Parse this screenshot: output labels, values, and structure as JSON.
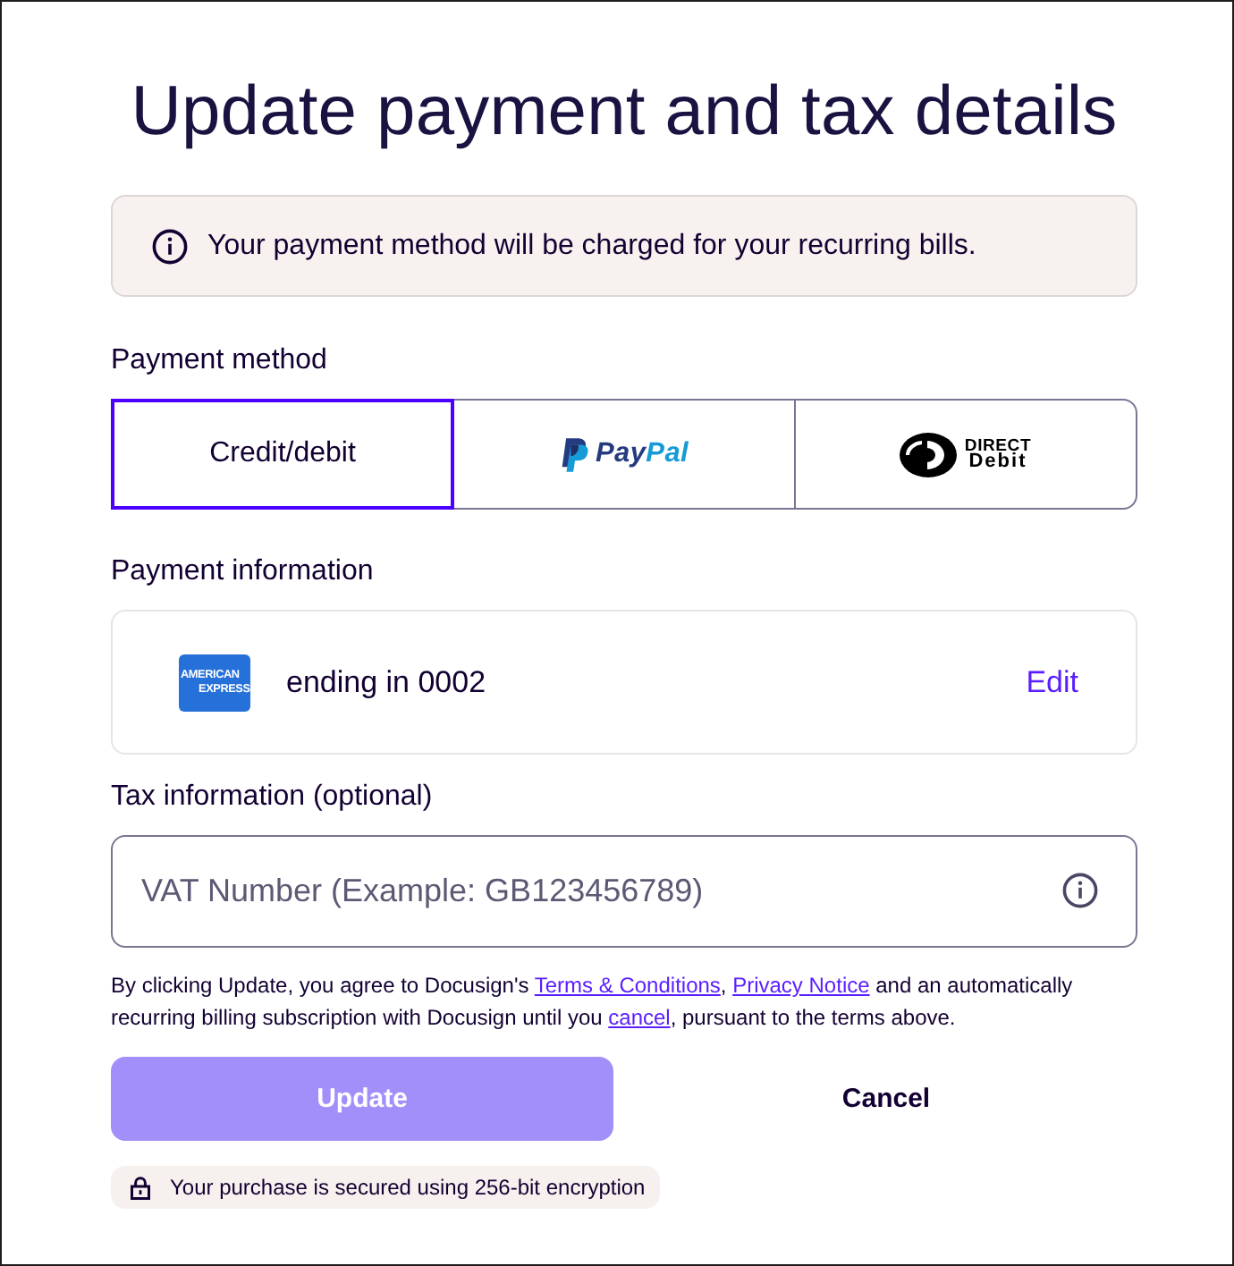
{
  "title": "Update payment and tax details",
  "notice": {
    "text": "Your payment method will be charged for your recurring bills."
  },
  "payment_method": {
    "label": "Payment method",
    "options": [
      {
        "kind": "text",
        "label": "Credit/debit",
        "selected": true
      },
      {
        "kind": "paypal",
        "label_parts": [
          "Pay",
          "Pal"
        ],
        "selected": false
      },
      {
        "kind": "direct_debit",
        "lines": [
          "DIRECT",
          "Debit"
        ],
        "selected": false
      }
    ]
  },
  "payment_information": {
    "label": "Payment information",
    "card": {
      "logo_lines": [
        "AMERICAN",
        "EXPRESS"
      ],
      "description": "ending in 0002",
      "action": "Edit"
    }
  },
  "tax_information": {
    "label": "Tax information (optional)",
    "vat_field": {
      "placeholder": "VAT Number (Example: GB123456789)"
    }
  },
  "legal": {
    "segments": [
      {
        "kind": "text",
        "text": "By clicking Update, you agree to Docusign's "
      },
      {
        "kind": "link",
        "text": "Terms & Conditions"
      },
      {
        "kind": "text",
        "text": ", "
      },
      {
        "kind": "link",
        "text": "Privacy Notice"
      },
      {
        "kind": "text",
        "text": " and an automatically recurring billing subscription with Docusign until you "
      },
      {
        "kind": "link",
        "text": "cancel"
      },
      {
        "kind": "text",
        "text": ", pursuant to the terms above."
      }
    ]
  },
  "actions": [
    {
      "kind": "primary",
      "label": "Update",
      "disabled": true
    },
    {
      "kind": "secondary",
      "label": "Cancel",
      "disabled": false
    }
  ],
  "security_note": {
    "text": "Your purchase is secured using 256-bit encryption"
  }
}
